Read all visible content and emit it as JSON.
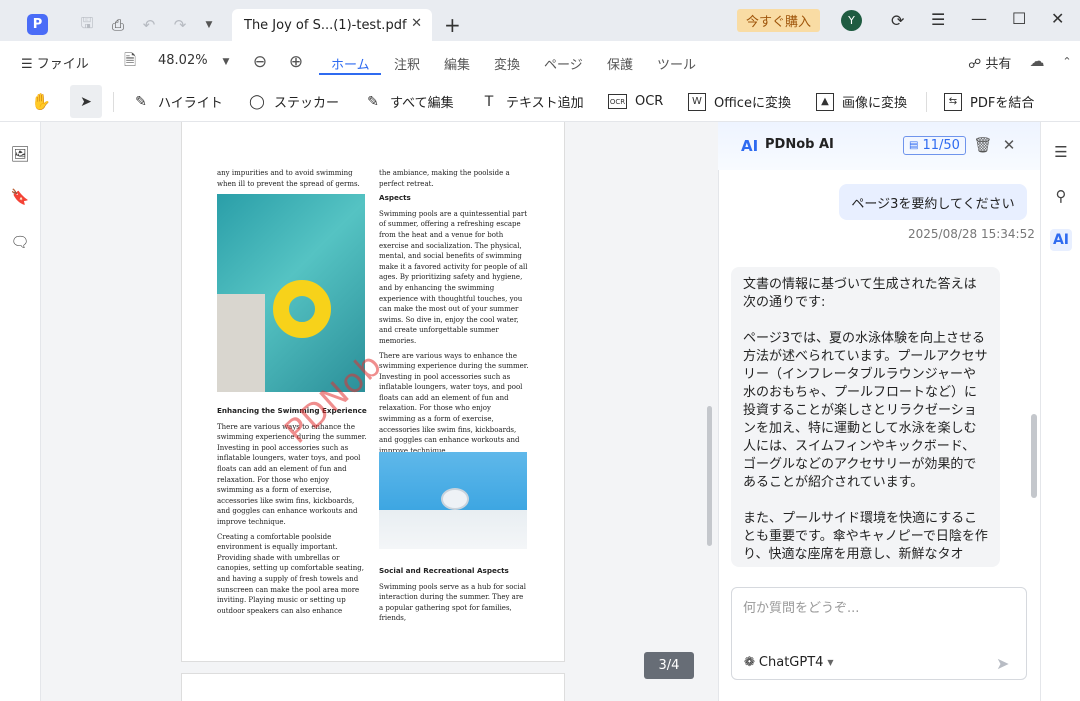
{
  "titlebar": {
    "app_icon": "pdnob-logo-icon",
    "tab_title": "The Joy of S...(1)-test.pdf",
    "buy_label": "今すぐ購入",
    "avatar_initial": "Y"
  },
  "menubar": {
    "file_label": "ファイル",
    "zoom": "48.02%",
    "tabs": [
      "ホーム",
      "注釈",
      "編集",
      "変換",
      "ページ",
      "保護",
      "ツール"
    ],
    "active_tab": "ホーム",
    "share_label": "共有"
  },
  "toolbar": {
    "highlight": "ハイライト",
    "sticker": "ステッカー",
    "edit_all": "すべて編集",
    "add_text": "テキスト追加",
    "ocr": "OCR",
    "to_office": "Officeに変換",
    "to_image": "画像に変換",
    "merge_pdf": "PDFを結合"
  },
  "document": {
    "left_col": {
      "intro": "any impurities and to avoid swimming when ill to prevent the spread of germs.",
      "heading": "Enhancing the Swimming Experience",
      "para1": "There are various ways to enhance the swimming experience during the summer. Investing in pool accessories such as inflatable loungers, water toys, and pool floats can add an element of fun and relaxation. For those who enjoy swimming as a form of exercise, accessories like swim fins, kickboards, and goggles can enhance workouts and improve technique.",
      "para2": "Creating a comfortable poolside environment is equally important. Providing shade with umbrellas or canopies, setting up comfortable seating, and having a supply of fresh towels and sunscreen can make the pool area more inviting. Playing music or setting up outdoor speakers can also enhance"
    },
    "right_col": {
      "intro": "the ambiance, making the poolside a perfect retreat.",
      "heading1": "Aspects",
      "para1": "Swimming pools are a quintessential part of summer, offering a refreshing escape from the heat and a venue for both exercise and socialization. The physical, mental, and social benefits of swimming make it a favored activity for people of all ages. By prioritizing safety and hygiene, and by enhancing the swimming experience with thoughtful touches, you can make the most out of your summer swims. So dive in, enjoy the cool water, and create unforgettable summer memories.",
      "para2": "There are various ways to enhance the swimming experience during the summer. Investing in pool accessories such as inflatable loungers, water toys, and pool floats can add an element of fun and relaxation. For those who enjoy swimming as a form of exercise, accessories like swim fins, kickboards, and goggles can enhance workouts and improve technique.",
      "heading2": "Social and Recreational Aspects",
      "para3": "Swimming pools serve as a hub for social interaction during the summer. They are a popular gathering spot for families, friends,"
    },
    "watermark": "PDNob",
    "page_indicator": "3/4"
  },
  "ai_panel": {
    "logo": "AI",
    "title": "PDNob AI",
    "count": "11/50",
    "user_message": "ページ3を要約してください",
    "timestamp": "2025/08/28 15:34:52",
    "answer_paragraphs": [
      "文書の情報に基づいて生成された答えは次の通りです:",
      "ページ3では、夏の水泳体験を向上させる方法が述べられています。プールアクセサリー（インフレータブルラウンジャーや水のおもちゃ、プールフロートなど）に投資することが楽しさとリラクゼーションを加え、特に運動として水泳を楽しむ人には、スイムフィンやキックボード、ゴーグルなどのアクセサリーが効果的であることが紹介されています。",
      "また、プールサイド環境を快適にすることも重要です。傘やキャノピーで日陰を作り、快適な座席を用意し、新鮮なタオ"
    ],
    "input_placeholder": "何か質問をどうぞ...",
    "model": "ChatGPT4"
  }
}
